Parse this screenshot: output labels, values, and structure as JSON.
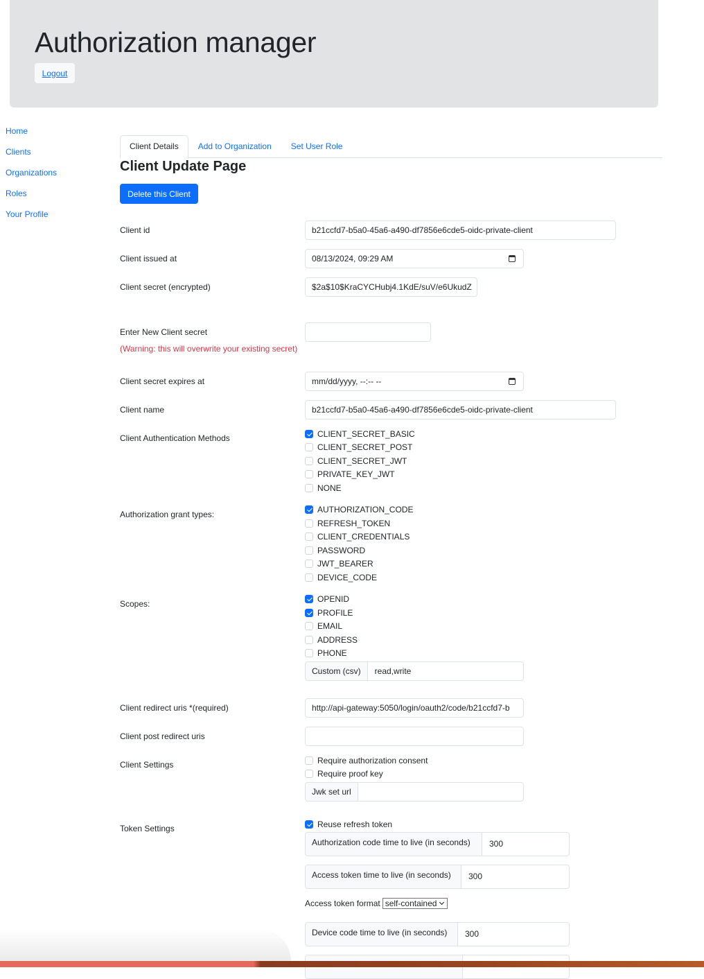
{
  "header": {
    "title": "Authorization manager",
    "logout_label": "Logout"
  },
  "sidebar": {
    "items": [
      {
        "label": "Home"
      },
      {
        "label": "Clients"
      },
      {
        "label": "Organizations"
      },
      {
        "label": "Roles"
      },
      {
        "label": "Your Profile"
      }
    ]
  },
  "tabs": [
    {
      "label": "Client Details",
      "active": true
    },
    {
      "label": "Add to Organization",
      "active": false
    },
    {
      "label": "Set User Role",
      "active": false
    }
  ],
  "page": {
    "title": "Client Update Page",
    "delete_button": "Delete this Client"
  },
  "form": {
    "client_id": {
      "label": "Client id",
      "value": "b21ccfd7-b5a0-45a6-a490-df7856e6cde5-oidc-private-client"
    },
    "issued_at": {
      "label": "Client issued at",
      "value": "08/13/2024, 09:29 AM"
    },
    "secret_encrypted": {
      "label": "Client secret (encrypted)",
      "value": "$2a$10$KraCYCHubj4.1KdE/suV/e6UkudZ"
    },
    "new_secret": {
      "label": "Enter New Client secret",
      "value": "",
      "warning": "(Warning: this will overwrite your existing secret)"
    },
    "secret_expires": {
      "label": "Client secret expires at",
      "value": "mm/dd/yyyy, --:-- --"
    },
    "client_name": {
      "label": "Client name",
      "value": "b21ccfd7-b5a0-45a6-a490-df7856e6cde5-oidc-private-client"
    },
    "auth_methods": {
      "label": "Client Authentication Methods",
      "options": [
        {
          "label": "CLIENT_SECRET_BASIC",
          "checked": true
        },
        {
          "label": "CLIENT_SECRET_POST",
          "checked": false
        },
        {
          "label": "CLIENT_SECRET_JWT",
          "checked": false
        },
        {
          "label": "PRIVATE_KEY_JWT",
          "checked": false
        },
        {
          "label": "NONE",
          "checked": false
        }
      ]
    },
    "grant_types": {
      "label": "Authorization grant types:",
      "options": [
        {
          "label": "AUTHORIZATION_CODE",
          "checked": true
        },
        {
          "label": "REFRESH_TOKEN",
          "checked": false
        },
        {
          "label": "CLIENT_CREDENTIALS",
          "checked": false
        },
        {
          "label": "PASSWORD",
          "checked": false
        },
        {
          "label": "JWT_BEARER",
          "checked": false
        },
        {
          "label": "DEVICE_CODE",
          "checked": false
        }
      ]
    },
    "scopes": {
      "label": "Scopes:",
      "options": [
        {
          "label": "OPENID",
          "checked": true
        },
        {
          "label": "PROFILE",
          "checked": true
        },
        {
          "label": "EMAIL",
          "checked": false
        },
        {
          "label": "ADDRESS",
          "checked": false
        },
        {
          "label": "PHONE",
          "checked": false
        }
      ],
      "custom_label": "Custom (csv)",
      "custom_value": "read,write"
    },
    "redirect_uris": {
      "label": "Client redirect uris *(required)",
      "value": "http://api-gateway:5050/login/oauth2/code/b21ccfd7-b"
    },
    "post_redirect_uris": {
      "label": "Client post redirect uris",
      "value": ""
    },
    "client_settings": {
      "label": "Client Settings",
      "options": [
        {
          "label": "Require authorization consent",
          "checked": false
        },
        {
          "label": "Require proof key",
          "checked": false
        }
      ],
      "jwk_label": "Jwk set url",
      "jwk_value": ""
    },
    "token_settings": {
      "label": "Token Settings",
      "reuse_refresh": {
        "label": "Reuse refresh token",
        "checked": true
      },
      "auth_code_ttl": {
        "label": "Authorization code time to live (in seconds)",
        "value": "300"
      },
      "access_token_ttl": {
        "label": "Access token time to live (in seconds)",
        "value": "300"
      },
      "access_token_format": {
        "label": "Access token format",
        "value": "self-contained"
      },
      "device_code_ttl": {
        "label": "Device code time to live (in seconds)",
        "value": "300"
      }
    }
  }
}
